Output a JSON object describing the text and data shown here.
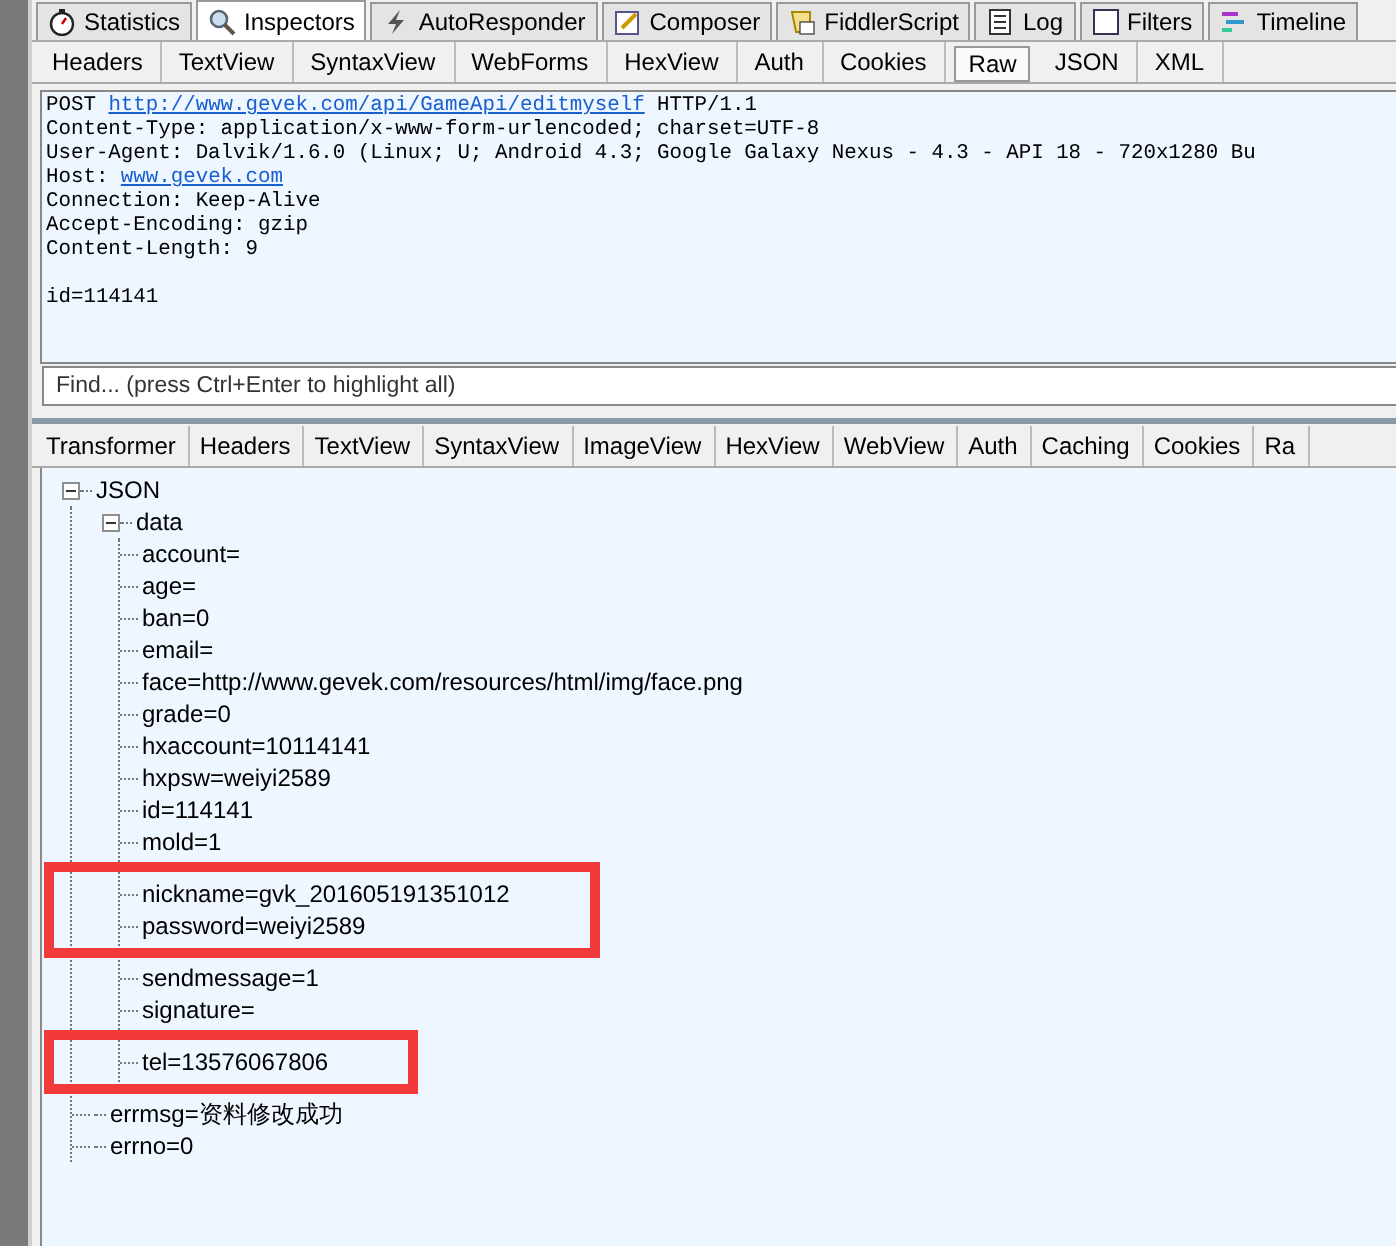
{
  "top_tabs": [
    {
      "label": "Statistics",
      "selected": false
    },
    {
      "label": "Inspectors",
      "selected": true
    },
    {
      "label": "AutoResponder",
      "selected": false
    },
    {
      "label": "Composer",
      "selected": false
    },
    {
      "label": "FiddlerScript",
      "selected": false
    },
    {
      "label": "Log",
      "selected": false
    },
    {
      "label": "Filters",
      "selected": false
    },
    {
      "label": "Timeline",
      "selected": false
    }
  ],
  "request_tabs": [
    {
      "label": "Headers",
      "selected": false
    },
    {
      "label": "TextView",
      "selected": false
    },
    {
      "label": "SyntaxView",
      "selected": false
    },
    {
      "label": "WebForms",
      "selected": false
    },
    {
      "label": "HexView",
      "selected": false
    },
    {
      "label": "Auth",
      "selected": false
    },
    {
      "label": "Cookies",
      "selected": false
    },
    {
      "label": "Raw",
      "selected": true
    },
    {
      "label": "JSON",
      "selected": false
    },
    {
      "label": "XML",
      "selected": false
    }
  ],
  "raw_request": {
    "lines": [
      [
        {
          "kind": "plain",
          "text": "POST "
        },
        {
          "kind": "link",
          "text": "http://www.gevek.com/api/GameApi/editmyself"
        },
        {
          "kind": "plain",
          "text": " HTTP/1.1"
        }
      ],
      [
        {
          "kind": "plain",
          "text": "Content-Type: application/x-www-form-urlencoded; charset=UTF-8"
        }
      ],
      [
        {
          "kind": "plain",
          "text": "User-Agent: Dalvik/1.6.0 (Linux; U; Android 4.3; Google Galaxy Nexus - 4.3 - API 18 - 720x1280 Bu"
        }
      ],
      [
        {
          "kind": "plain",
          "text": "Host: "
        },
        {
          "kind": "link",
          "text": "www.gevek.com"
        }
      ],
      [
        {
          "kind": "plain",
          "text": "Connection: Keep-Alive"
        }
      ],
      [
        {
          "kind": "plain",
          "text": "Accept-Encoding: gzip"
        }
      ],
      [
        {
          "kind": "plain",
          "text": "Content-Length: 9"
        }
      ]
    ],
    "body": "id=114141"
  },
  "find": {
    "placeholder": "Find... (press Ctrl+Enter to highlight all)"
  },
  "response_tabs": [
    {
      "label": "Transformer",
      "selected": false
    },
    {
      "label": "Headers",
      "selected": false
    },
    {
      "label": "TextView",
      "selected": false
    },
    {
      "label": "SyntaxView",
      "selected": false
    },
    {
      "label": "ImageView",
      "selected": false
    },
    {
      "label": "HexView",
      "selected": false
    },
    {
      "label": "WebView",
      "selected": false
    },
    {
      "label": "Auth",
      "selected": false
    },
    {
      "label": "Caching",
      "selected": false
    },
    {
      "label": "Cookies",
      "selected": false
    },
    {
      "label": "Ra",
      "selected": false
    }
  ],
  "tree": {
    "label": "JSON",
    "expanded": true,
    "children": [
      {
        "label": "data",
        "expanded": true,
        "children": [
          {
            "label": "account=",
            "highlighted": false
          },
          {
            "label": "age=",
            "highlighted": false
          },
          {
            "label": "ban=0",
            "highlighted": false
          },
          {
            "label": "email=",
            "highlighted": false
          },
          {
            "label": "face=http://www.gevek.com/resources/html/img/face.png",
            "highlighted": false
          },
          {
            "label": "grade=0",
            "highlighted": false
          },
          {
            "label": "hxaccount=10114141",
            "highlighted": false
          },
          {
            "label": "hxpsw=weiyi2589",
            "highlighted": false
          },
          {
            "label": "id=114141",
            "highlighted": false
          },
          {
            "label": "mold=1",
            "highlighted": false
          },
          {
            "label": "nickname=gvk_201605191351012",
            "highlighted": true
          },
          {
            "label": "password=weiyi2589",
            "highlighted": true
          },
          {
            "label": "sendmessage=1",
            "highlighted": false
          },
          {
            "label": "signature=",
            "highlighted": false
          },
          {
            "label": "tel=13576067806",
            "highlighted": true
          }
        ]
      },
      {
        "label": "errmsg=资料修改成功"
      },
      {
        "label": "errno=0"
      }
    ]
  }
}
